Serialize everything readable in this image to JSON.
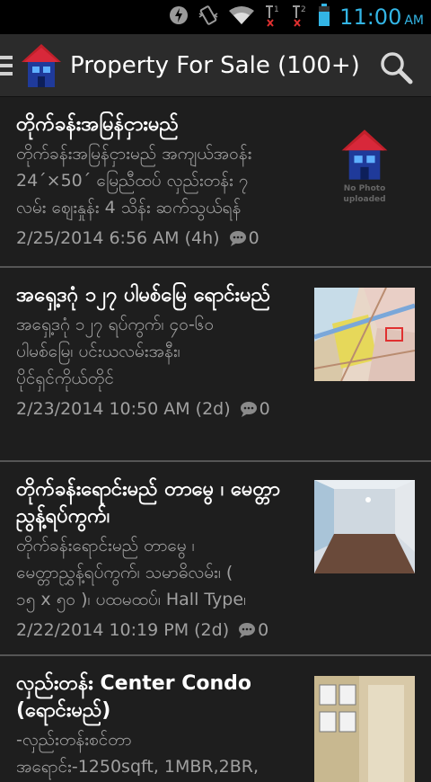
{
  "status": {
    "time": "11:00",
    "ampm": "AM",
    "sim1": "1",
    "sim2": "2"
  },
  "header": {
    "title": "Property For Sale (100+)"
  },
  "listings": [
    {
      "title": "တိုက်ခန်းအမြန်ငှားမည်",
      "desc": [
        "တိုက်ခန်းအမြန်ငှားမည် အကျယ်အဝန်း",
        "24´×50´ မြေညီထပ် လှည်းတန်း ၇",
        "လမ်း ဈေးနှုန်း 4 သိန်း ဆက်သွယ်ရန်"
      ],
      "date": "2/25/2014 6:56 AM (4h)",
      "comments": "0",
      "photo_placeholder": [
        "No Photo",
        "uploaded"
      ]
    },
    {
      "title": "အရှေ့ဒဂုံ ၁၂၇ ပါမစ်မြေ ရောင်းမည်",
      "desc": [
        "အရှေ့ဒဂုံ ၁၂၇ ရပ်ကွက်၊ ၄၀-၆၀",
        "ပါမစ်မြေ၊ ပင်းယလမ်းအနီး၊",
        "ပိုင်ရှင်ကိုယ်တိုင်"
      ],
      "date": "2/23/2014 10:50 AM (2d)",
      "comments": "0"
    },
    {
      "title": "တိုက်ခန်းရောင်းမည် တာမွေ ၊ မေတ္တာညွန့်ရပ်ကွက်၊",
      "desc": [
        "တိုက်ခန်းရောင်းမည် တာမွေ ၊",
        "မေတ္တာညွှန့်ရပ်ကွက်၊ သမာဓိလမ်း၊ (",
        "၁၅ x ၅၀ )၊ ပထမထပ်၊ Hall Type၊"
      ],
      "date": "2/22/2014 10:19 PM (2d)",
      "comments": "0"
    },
    {
      "title": "လှည်းတန်း Center Condo (ရောင်းမည်)",
      "desc": [
        "-လှည်းတန်းစင်တာ",
        "အရောင်း-1250sqft, 1MBR,2BR,"
      ],
      "date": "",
      "comments": ""
    }
  ]
}
